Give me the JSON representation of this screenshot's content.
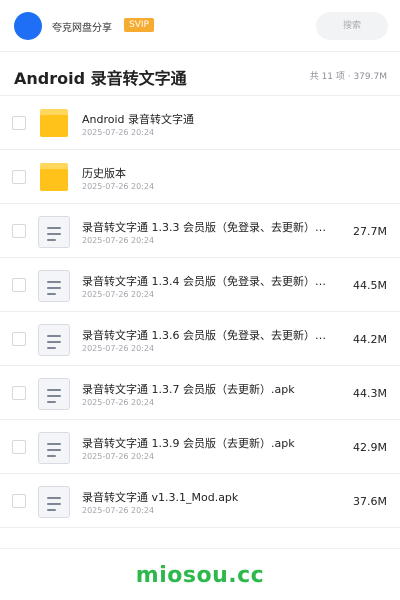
{
  "header_bar": {
    "share_title": "夸克网盘分享",
    "svip_badge": "SVIP",
    "search_placeholder": "搜索"
  },
  "folder": {
    "title": "Android 录音转文字通",
    "summary": "共 11 项 · 379.7M"
  },
  "files": [
    {
      "type": "folder",
      "name": "Android 录音转文字通",
      "date": "2025-07-26 20:24",
      "size": ""
    },
    {
      "type": "folder",
      "name": "历史版本",
      "date": "2025-07-26 20:24",
      "size": ""
    },
    {
      "type": "file",
      "name": "录音转文字通 1.3.3 会员版（免登录、去更新）…",
      "date": "2025-07-26 20:24",
      "size": "27.7M"
    },
    {
      "type": "file",
      "name": "录音转文字通 1.3.4 会员版（免登录、去更新）…",
      "date": "2025-07-26 20:24",
      "size": "44.5M"
    },
    {
      "type": "file",
      "name": "录音转文字通 1.3.6 会员版（免登录、去更新）…",
      "date": "2025-07-26 20:24",
      "size": "44.2M"
    },
    {
      "type": "file",
      "name": "录音转文字通 1.3.7 会员版（去更新）.apk",
      "date": "2025-07-26 20:24",
      "size": "44.3M"
    },
    {
      "type": "file",
      "name": "录音转文字通 1.3.9 会员版（去更新）.apk",
      "date": "2025-07-26 20:24",
      "size": "42.9M"
    },
    {
      "type": "file",
      "name": "录音转文字通 v1.3.1_Mod.apk",
      "date": "2025-07-26 20:24",
      "size": "37.6M"
    }
  ],
  "watermark": "miosou.cc",
  "colors": {
    "avatar": "#1e6ff5",
    "svip": "#f7ab31",
    "folder": "#ffc21a",
    "watermark": "#2eb84b"
  }
}
